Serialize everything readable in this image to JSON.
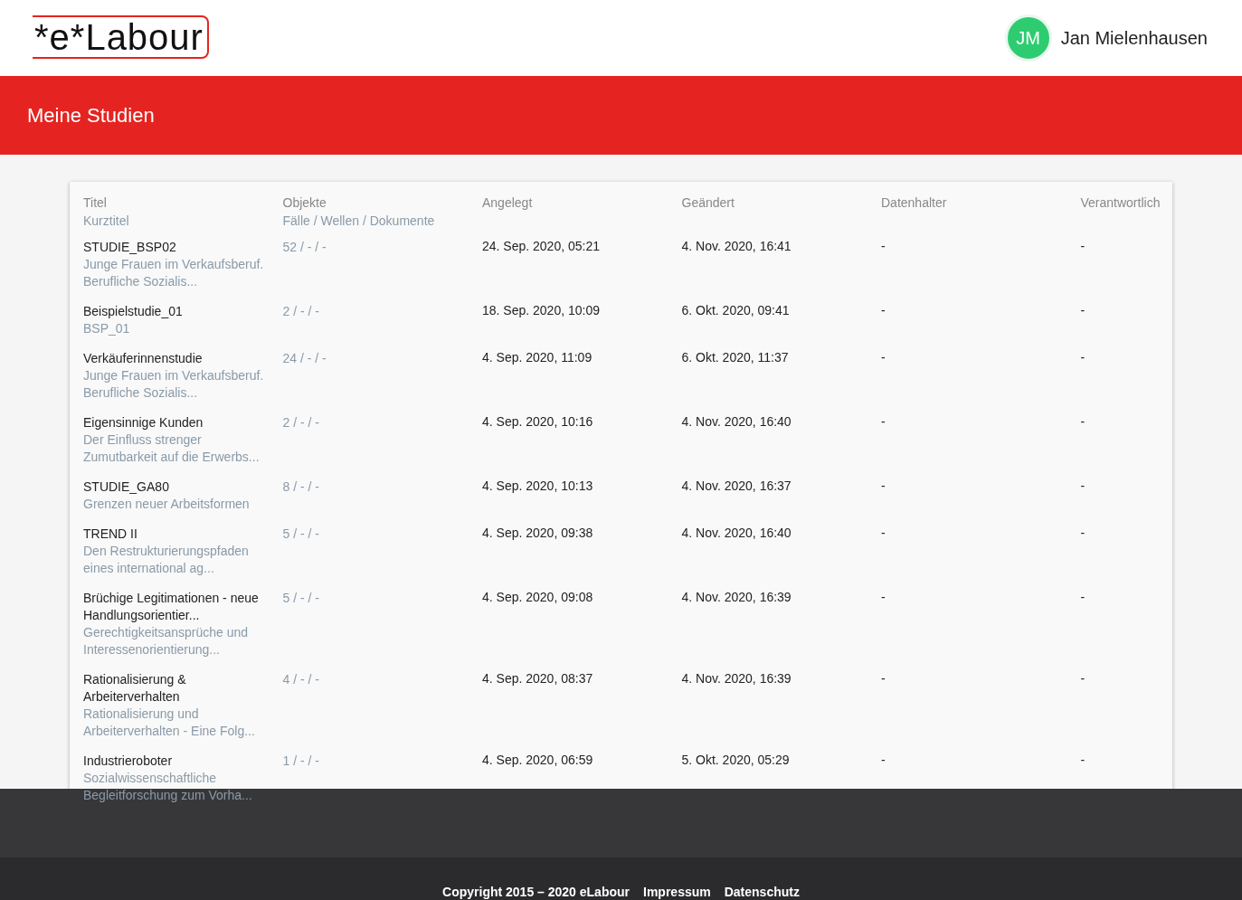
{
  "logo": "*e*Labour",
  "user": {
    "initials": "JM",
    "name": "Jan Mielenhausen"
  },
  "page_title": "Meine Studien",
  "table": {
    "columns": [
      {
        "label": "Titel",
        "sublabel": "Kurztitel"
      },
      {
        "label": "Objekte",
        "sublabel": "Fälle / Wellen / Dokumente"
      },
      {
        "label": "Angelegt"
      },
      {
        "label": "Geändert"
      },
      {
        "label": "Datenhalter"
      },
      {
        "label": "Verantwortlich"
      }
    ],
    "rows": [
      {
        "title": "STUDIE_BSP02",
        "short": "Junge Frauen im Verkaufsberuf. Berufliche Sozialis...",
        "objects": "52 / - / -",
        "created": "24. Sep. 2020, 05:21",
        "changed": "4. Nov. 2020, 16:41",
        "holder": "-",
        "responsible": "-"
      },
      {
        "title": "Beispielstudie_01",
        "short": "BSP_01",
        "objects": "2 / - / -",
        "created": "18. Sep. 2020, 10:09",
        "changed": "6. Okt. 2020, 09:41",
        "holder": "-",
        "responsible": "-"
      },
      {
        "title": "Verkäuferinnenstudie",
        "short": "Junge Frauen im Verkaufsberuf. Berufliche Sozialis...",
        "objects": "24 / - / -",
        "created": "4. Sep. 2020, 11:09",
        "changed": "6. Okt. 2020, 11:37",
        "holder": "-",
        "responsible": "-"
      },
      {
        "title": "Eigensinnige Kunden",
        "short": "Der Einfluss strenger Zumutbarkeit auf die Erwerbs...",
        "objects": "2 / - / -",
        "created": "4. Sep. 2020, 10:16",
        "changed": "4. Nov. 2020, 16:40",
        "holder": "-",
        "responsible": "-"
      },
      {
        "title": "STUDIE_GA80",
        "short": "Grenzen neuer Arbeitsformen",
        "objects": "8 / - / -",
        "created": "4. Sep. 2020, 10:13",
        "changed": "4. Nov. 2020, 16:37",
        "holder": "-",
        "responsible": "-"
      },
      {
        "title": "TREND II",
        "short": "Den Restrukturierungspfaden eines international ag...",
        "objects": "5 / - / -",
        "created": "4. Sep. 2020, 09:38",
        "changed": "4. Nov. 2020, 16:40",
        "holder": "-",
        "responsible": "-"
      },
      {
        "title": "Brüchige Legitimationen - neue Handlungsorientier...",
        "short": "Gerechtigkeitsansprüche und Interessenorientierung...",
        "objects": "5 / - / -",
        "created": "4. Sep. 2020, 09:08",
        "changed": "4. Nov. 2020, 16:39",
        "holder": "-",
        "responsible": "-"
      },
      {
        "title": "Rationalisierung & Arbeiterverhalten",
        "short": "Rationalisierung und Arbeiterverhalten - Eine Folg...",
        "objects": "4 / - / -",
        "created": "4. Sep. 2020, 08:37",
        "changed": "4. Nov. 2020, 16:39",
        "holder": "-",
        "responsible": "-"
      },
      {
        "title": "Industrieroboter",
        "short": "Sozialwissenschaftliche Begleitforschung zum Vorha...",
        "objects": "1 / - / -",
        "created": "4. Sep. 2020, 06:59",
        "changed": "5. Okt. 2020, 05:29",
        "holder": "-",
        "responsible": "-"
      }
    ]
  },
  "footer": {
    "copyright": "Copyright 2015 – 2020 eLabour",
    "links": [
      "Impressum",
      "Datenschutz"
    ]
  }
}
